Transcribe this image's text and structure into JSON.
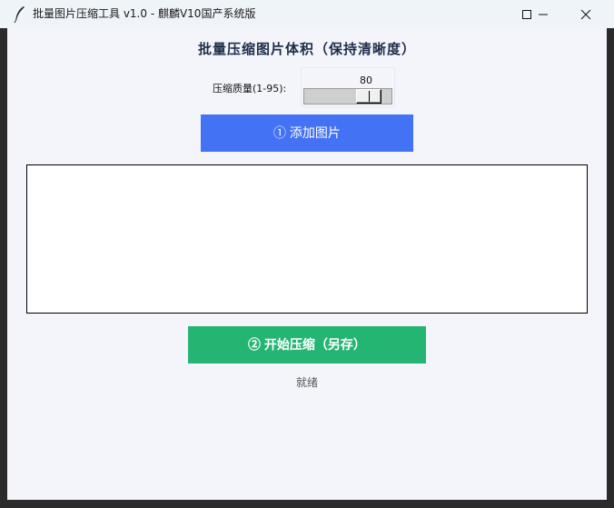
{
  "window": {
    "title": "批量图片压缩工具 v1.0 - 麒麟V10国产系统版",
    "icon": "feather-icon",
    "controls": [
      "minimize-icon",
      "maximize-icon",
      "close-icon"
    ]
  },
  "main": {
    "heading": "批量压缩图片体积（保持清晰度）",
    "quality": {
      "label": "压缩质量(1-95):",
      "value": "80",
      "min": 1,
      "max": 95
    },
    "add_button": "① 添加图片",
    "file_list": [],
    "start_button": "② 开始压缩（另存）",
    "status": "就绪"
  },
  "colors": {
    "add_button": "#4472f4",
    "start_button": "#25b573",
    "background": "#f3f5fa"
  }
}
